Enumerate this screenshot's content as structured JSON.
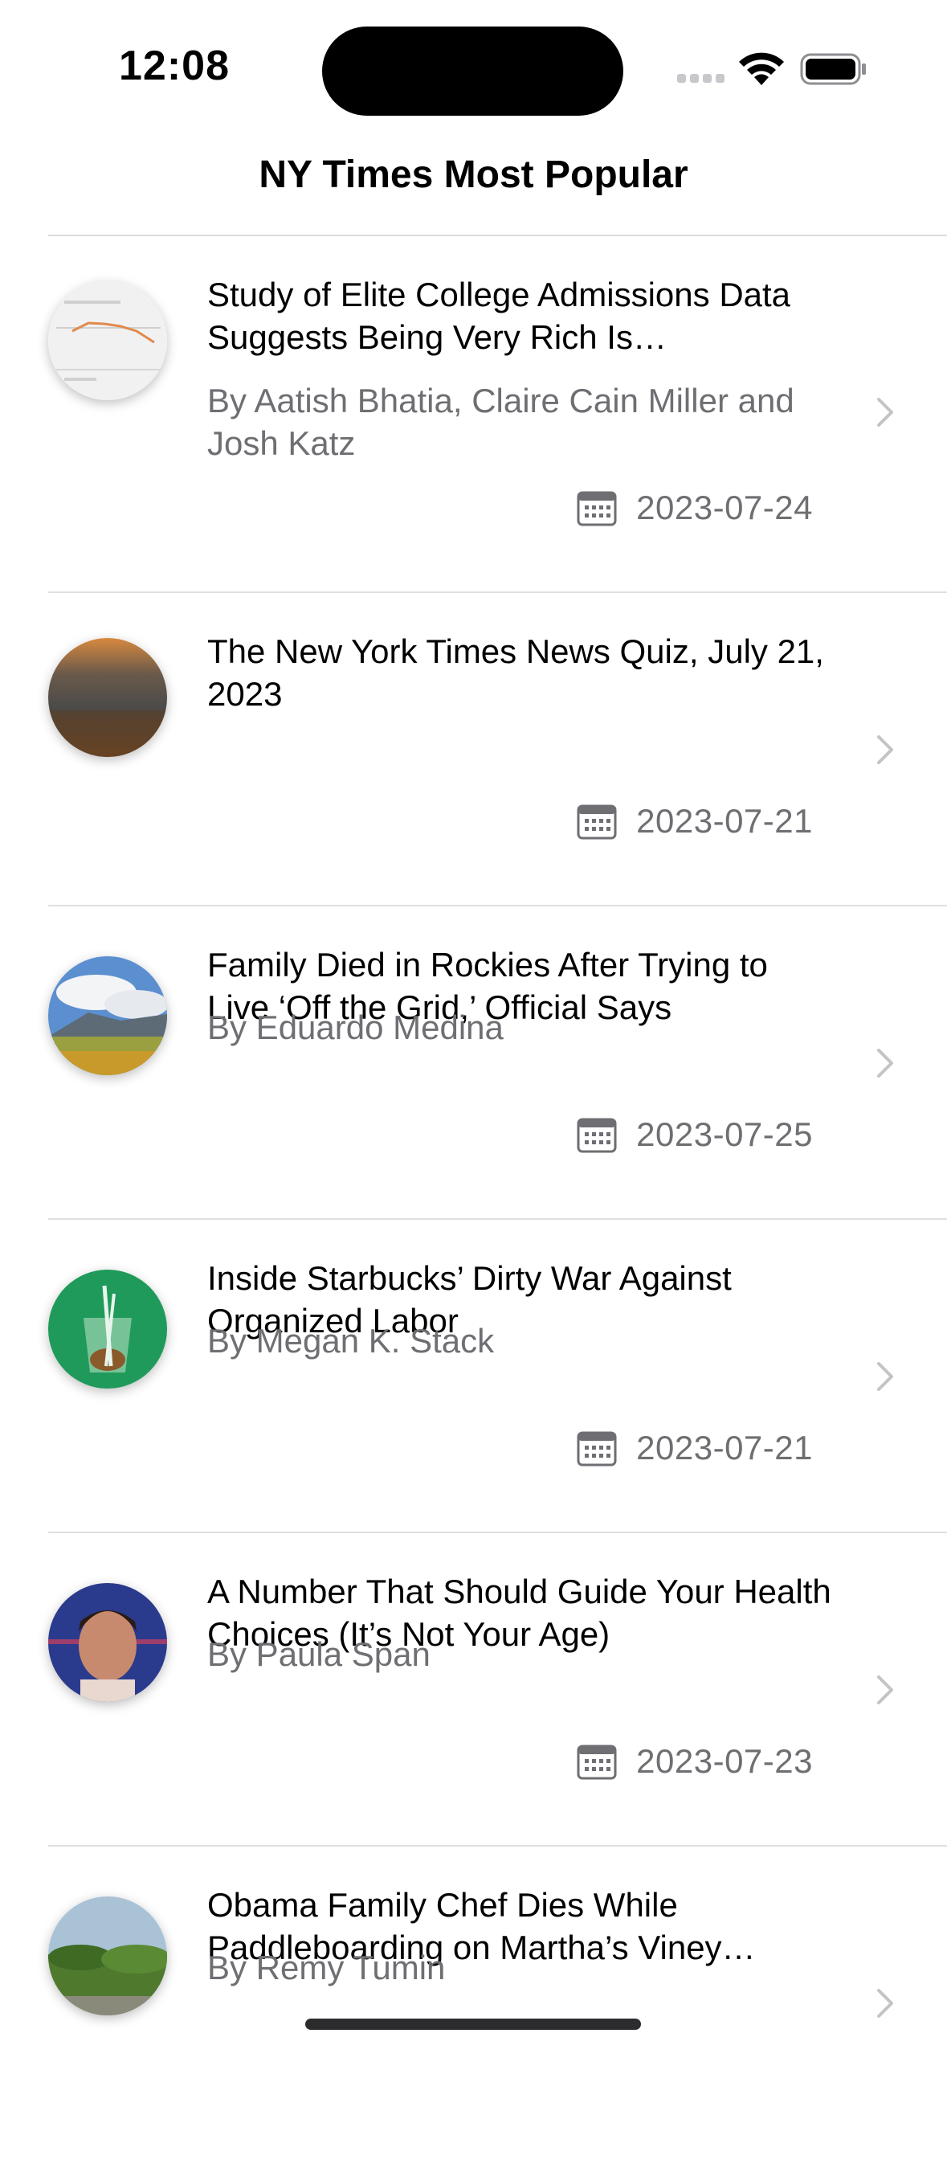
{
  "status_bar": {
    "time": "12:08"
  },
  "nav": {
    "title": "NY Times Most Popular"
  },
  "articles": [
    {
      "title": "Study of Elite College Admissions Data Suggests Being Very Rich Is…",
      "byline": "By Aatish Bhatia, Claire Cain Miller and Josh Katz",
      "date": "2023-07-24"
    },
    {
      "title": "The New York Times News Quiz, July 21, 2023",
      "byline": "",
      "date": "2023-07-21"
    },
    {
      "title": "Family Died in Rockies After Trying to Live ‘Off the Grid,’ Official Says",
      "byline": "By Eduardo Medina",
      "date": "2023-07-25"
    },
    {
      "title": "Inside Starbucks’ Dirty War Against Organized Labor",
      "byline": "By Megan K. Stack",
      "date": "2023-07-21"
    },
    {
      "title": "A Number That Should Guide Your Health Choices (It’s Not Your Age)",
      "byline": "By Paula Span",
      "date": "2023-07-23"
    },
    {
      "title": "Obama Family Chef Dies While Paddleboarding on Martha’s Viney…",
      "byline": "By Remy Tumin",
      "date": ""
    }
  ],
  "icons": {
    "chevron": "chevron-right-icon",
    "calendar": "calendar-icon"
  },
  "colors": {
    "secondary_text": "#6e6e73",
    "separator": "#e0e0e0",
    "chevron": "#c4c4c7"
  }
}
